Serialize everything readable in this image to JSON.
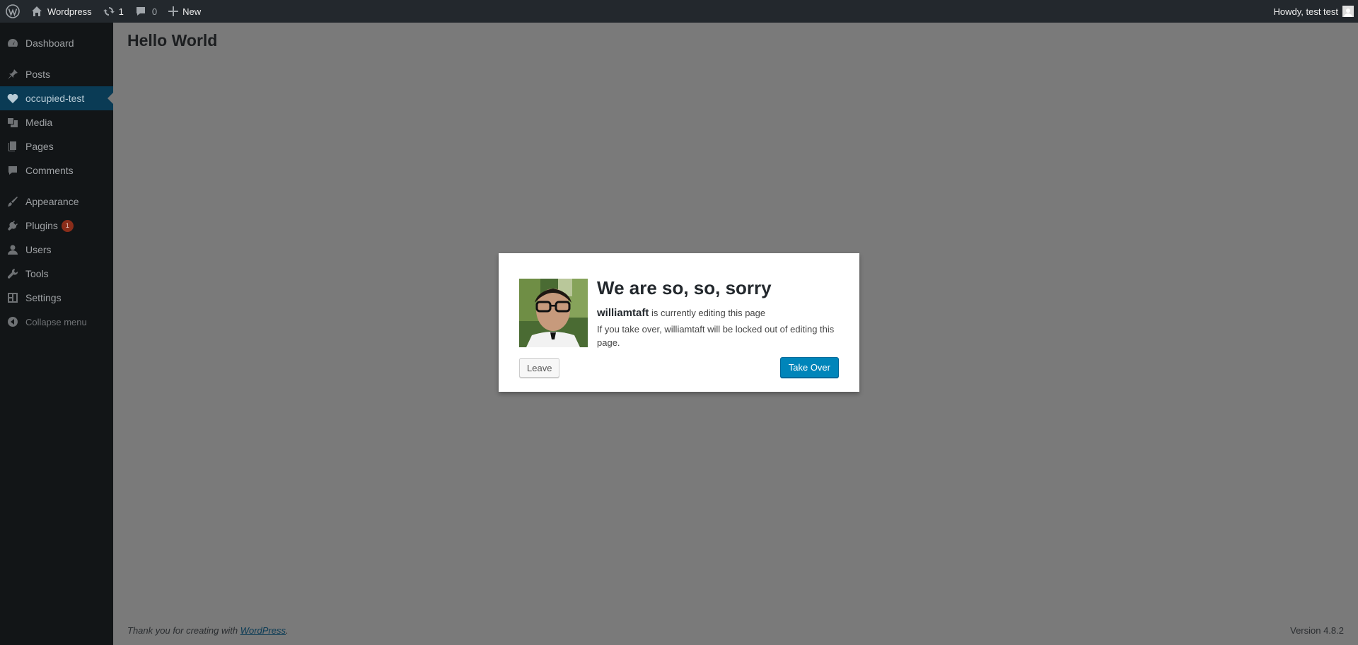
{
  "adminbar": {
    "site_name": "Wordpress",
    "updates_count": "1",
    "comments_count": "0",
    "new_label": "New",
    "greeting": "Howdy, test test"
  },
  "sidebar": {
    "items": [
      {
        "label": "Dashboard",
        "icon": "dashboard-icon"
      },
      {
        "label": "Posts",
        "icon": "pin-icon"
      },
      {
        "label": "occupied-test",
        "icon": "heart-icon"
      },
      {
        "label": "Media",
        "icon": "media-icon"
      },
      {
        "label": "Pages",
        "icon": "pages-icon"
      },
      {
        "label": "Comments",
        "icon": "comment-icon"
      },
      {
        "label": "Appearance",
        "icon": "brush-icon"
      },
      {
        "label": "Plugins",
        "icon": "plug-icon",
        "badge": "1"
      },
      {
        "label": "Users",
        "icon": "user-icon"
      },
      {
        "label": "Tools",
        "icon": "wrench-icon"
      },
      {
        "label": "Settings",
        "icon": "settings-icon"
      }
    ],
    "collapse_label": "Collapse menu"
  },
  "main": {
    "title": "Hello World"
  },
  "modal": {
    "heading": "We are so, so, sorry",
    "username": "williamtaft",
    "line1_suffix": " is currently editing this page",
    "line2": "If you take over, williamtaft will be locked out of editing this page.",
    "leave_label": "Leave",
    "takeover_label": "Take Over"
  },
  "footer": {
    "thanks_prefix": "Thank you for creating with ",
    "thanks_link": "WordPress",
    "thanks_suffix": ".",
    "version": "Version 4.8.2"
  },
  "colors": {
    "adminbar_bg": "#23282d",
    "sidebar_bg": "#121517",
    "current_item_bg": "#0a3b55",
    "primary_button": "#0085ba",
    "overlay_bg": "#7a7a7a"
  }
}
